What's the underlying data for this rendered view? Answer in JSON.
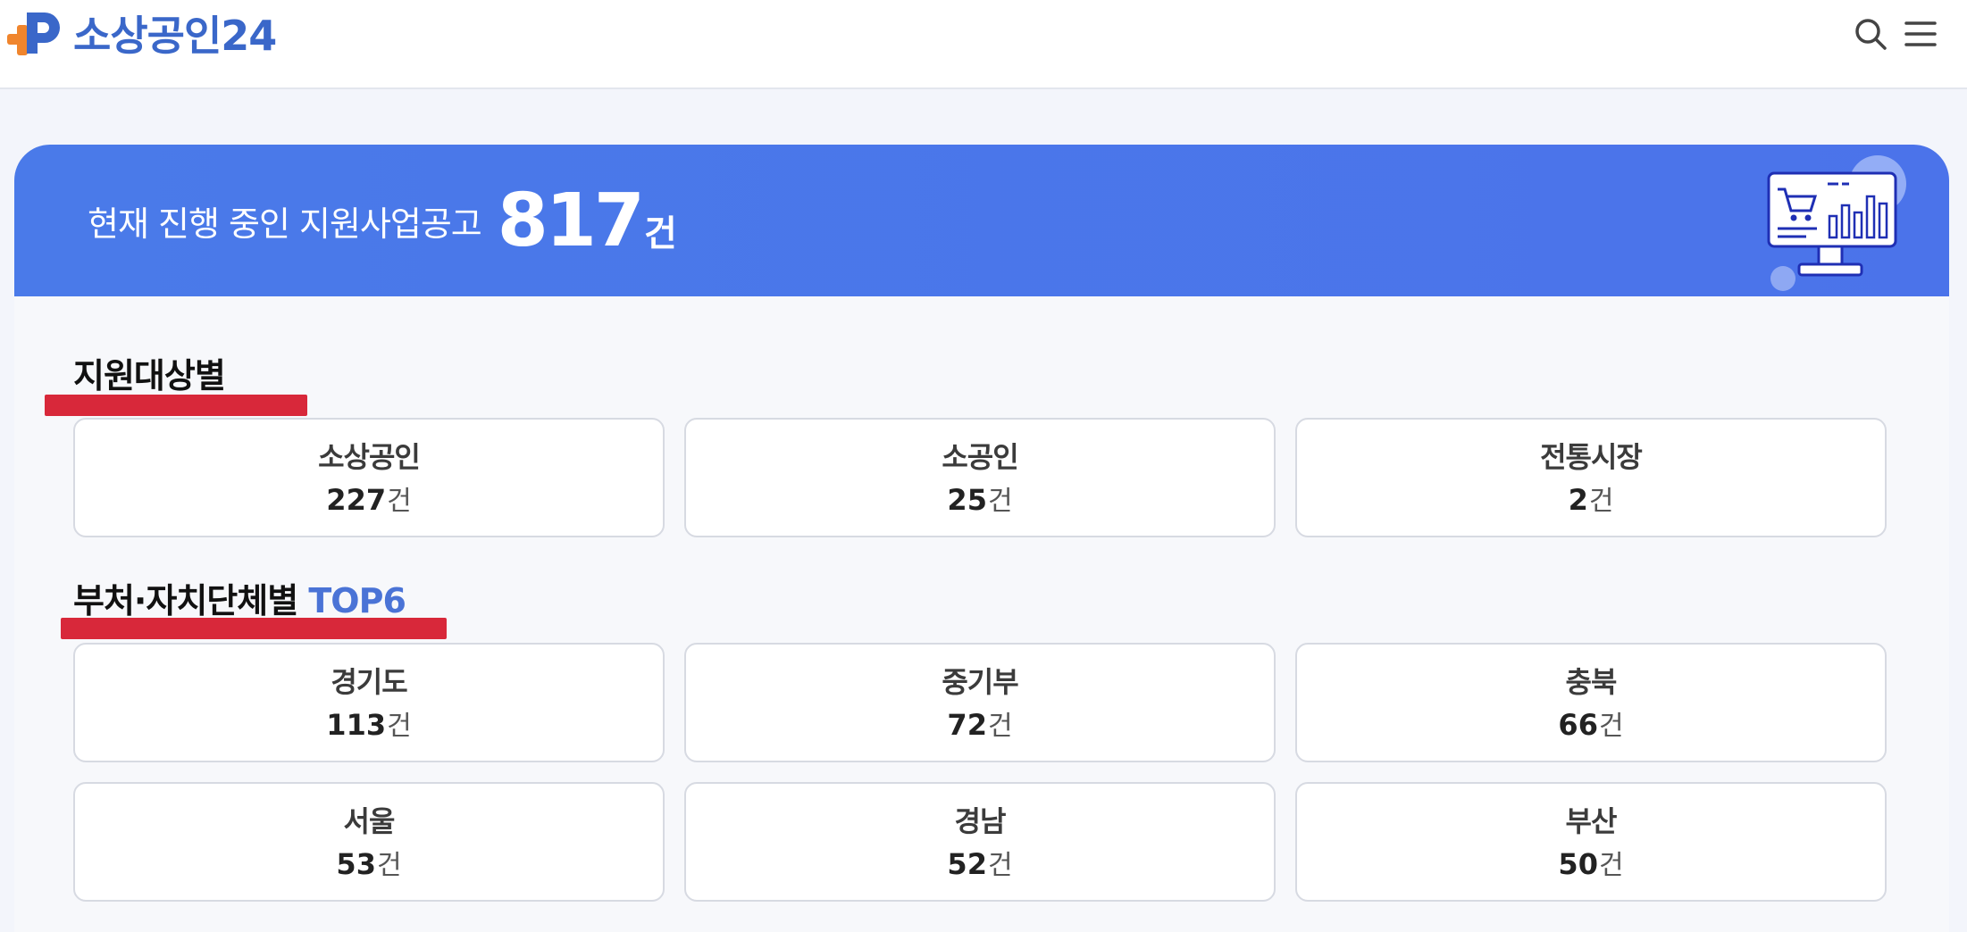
{
  "header": {
    "logo_text": "소상공인24",
    "search_icon": "search-icon",
    "menu_icon": "menu-icon",
    "brand_color": "#3a67c9"
  },
  "banner": {
    "label": "현재 진행 중인 지원사업공고",
    "count": "817",
    "unit": "건",
    "illustration_icon": "monitor-chart-cart-icon",
    "color": "#4a76e9"
  },
  "sections": [
    {
      "title": "지원대상별",
      "title_accent": "",
      "items": [
        {
          "label": "소상공인",
          "count": "227",
          "unit": "건"
        },
        {
          "label": "소공인",
          "count": "25",
          "unit": "건"
        },
        {
          "label": "전통시장",
          "count": "2",
          "unit": "건"
        }
      ]
    },
    {
      "title": "부처·자치단체별 ",
      "title_accent": "TOP6",
      "items": [
        {
          "label": "경기도",
          "count": "113",
          "unit": "건"
        },
        {
          "label": "중기부",
          "count": "72",
          "unit": "건"
        },
        {
          "label": "충북",
          "count": "66",
          "unit": "건"
        },
        {
          "label": "서울",
          "count": "53",
          "unit": "건"
        },
        {
          "label": "경남",
          "count": "52",
          "unit": "건"
        },
        {
          "label": "부산",
          "count": "50",
          "unit": "건"
        }
      ]
    }
  ],
  "colors": {
    "underline": "#d8283a",
    "accent": "#4a73d6"
  }
}
